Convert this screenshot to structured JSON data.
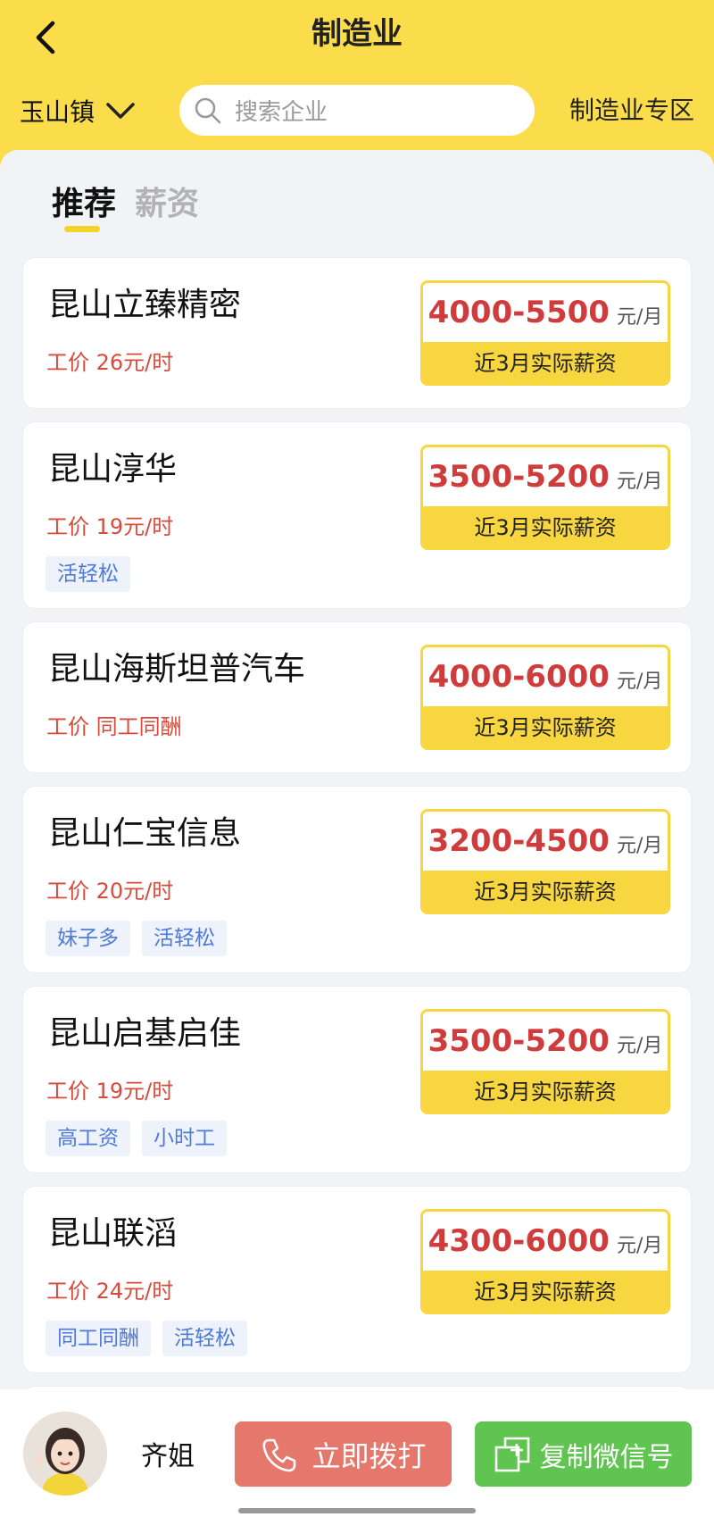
{
  "header": {
    "title": "制造业",
    "town": "玉山镇",
    "search_placeholder": "搜索企业",
    "zone_link": "制造业专区"
  },
  "tabs": [
    {
      "label": "推荐",
      "active": true
    },
    {
      "label": "薪资",
      "active": false
    }
  ],
  "companies": [
    {
      "name": "昆山立臻精密",
      "wage": "工价 26元/时",
      "salary": "4000-5500",
      "unit": "元/月",
      "note": "近3月实际薪资",
      "tags": []
    },
    {
      "name": "昆山淳华",
      "wage": "工价 19元/时",
      "salary": "3500-5200",
      "unit": "元/月",
      "note": "近3月实际薪资",
      "tags": [
        "活轻松"
      ]
    },
    {
      "name": "昆山海斯坦普汽车",
      "wage": "工价 同工同酬",
      "salary": "4000-6000",
      "unit": "元/月",
      "note": "近3月实际薪资",
      "tags": []
    },
    {
      "name": "昆山仁宝信息",
      "wage": "工价 20元/时",
      "salary": "3200-4500",
      "unit": "元/月",
      "note": "近3月实际薪资",
      "tags": [
        "妹子多",
        "活轻松"
      ]
    },
    {
      "name": "昆山启基启佳",
      "wage": "工价 19元/时",
      "salary": "3500-5200",
      "unit": "元/月",
      "note": "近3月实际薪资",
      "tags": [
        "高工资",
        "小时工"
      ]
    },
    {
      "name": "昆山联滔",
      "wage": "工价 24元/时",
      "salary": "4300-6000",
      "unit": "元/月",
      "note": "近3月实际薪资",
      "tags": [
        "同工同酬",
        "活轻松"
      ]
    }
  ],
  "footer": {
    "agent_name": "齐姐",
    "call_label": "立即拨打",
    "copy_wechat_label": "复制微信号"
  },
  "colors": {
    "brand_yellow": "#fbdd4c",
    "salary_red": "#d03c3c",
    "call_button": "#e5776c",
    "wechat_button": "#60c450",
    "tag_blue": "#4f7ad7"
  }
}
